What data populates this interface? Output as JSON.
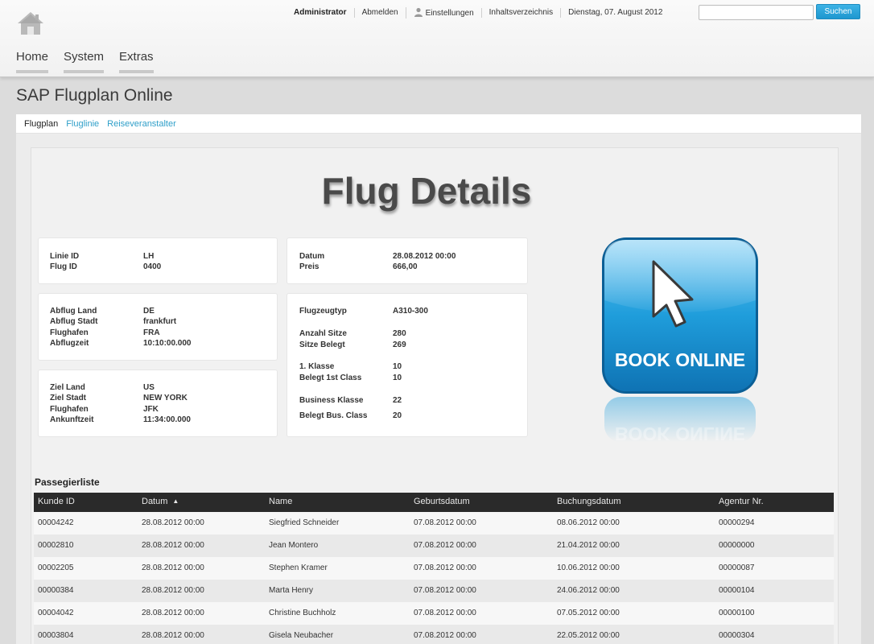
{
  "header": {
    "user": "Administrator",
    "logout": "Abmelden",
    "settings": "Einstellungen",
    "index": "Inhaltsverzeichnis",
    "date": "Dienstag, 07. August 2012",
    "search_button": "Suchen",
    "search_value": "",
    "nav": [
      "Home",
      "System",
      "Extras"
    ]
  },
  "page": {
    "title": "SAP Flugplan Online",
    "breadcrumbs": [
      "Flugplan",
      "Fluglinie",
      "Reiseveranstalter"
    ]
  },
  "details": {
    "title": "Flug Details",
    "flight": [
      {
        "label": "Linie ID",
        "value": "LH"
      },
      {
        "label": "Flug ID",
        "value": "0400"
      }
    ],
    "departure": [
      {
        "label": "Abflug Land",
        "value": "DE"
      },
      {
        "label": "Abflug Stadt",
        "value": "frankfurt"
      },
      {
        "label": "Flughafen",
        "value": "FRA"
      },
      {
        "label": "Abflugzeit",
        "value": "10:10:00.000"
      }
    ],
    "destination": [
      {
        "label": "Ziel Land",
        "value": "US"
      },
      {
        "label": "Ziel Stadt",
        "value": "NEW YORK"
      },
      {
        "label": "Flughafen",
        "value": "JFK"
      },
      {
        "label": "Ankunftzeit",
        "value": "11:34:00.000"
      }
    ],
    "date_price": [
      {
        "label": "Datum",
        "value": "28.08.2012 00:00"
      },
      {
        "label": "Preis",
        "value": "666,00"
      }
    ],
    "aircraft": [
      {
        "label": "Flugzeugtyp",
        "value": "A310-300"
      },
      {
        "label": "Anzahl Sitze",
        "value": "280"
      },
      {
        "label": "Sitze Belegt",
        "value": "269"
      },
      {
        "label": "1. Klasse",
        "value": "10"
      },
      {
        "label": "Belegt 1st Class",
        "value": "10"
      },
      {
        "label": "Business Klasse",
        "value": "22"
      },
      {
        "label": "Belegt Bus. Class",
        "value": "20"
      }
    ],
    "book_button": "BOOK ONLINE",
    "accent_color": "#1e9ad8"
  },
  "passengers": {
    "title": "Passegierliste",
    "columns": [
      "Kunde ID",
      "Datum",
      "Name",
      "Geburtsdatum",
      "Buchungsdatum",
      "Agentur Nr."
    ],
    "rows": [
      [
        "00004242",
        "28.08.2012 00:00",
        "Siegfried Schneider",
        "07.08.2012 00:00",
        "08.06.2012 00:00",
        "00000294"
      ],
      [
        "00002810",
        "28.08.2012 00:00",
        "Jean Montero",
        "07.08.2012 00:00",
        "21.04.2012 00:00",
        "00000000"
      ],
      [
        "00002205",
        "28.08.2012 00:00",
        "Stephen Kramer",
        "07.08.2012 00:00",
        "10.06.2012 00:00",
        "00000087"
      ],
      [
        "00000384",
        "28.08.2012 00:00",
        "Marta Henry",
        "07.08.2012 00:00",
        "24.06.2012 00:00",
        "00000104"
      ],
      [
        "00004042",
        "28.08.2012 00:00",
        "Christine Buchholz",
        "07.08.2012 00:00",
        "07.05.2012 00:00",
        "00000100"
      ],
      [
        "00003804",
        "28.08.2012 00:00",
        "Gisela Neubacher",
        "07.08.2012 00:00",
        "22.05.2012 00:00",
        "00000304"
      ]
    ]
  }
}
